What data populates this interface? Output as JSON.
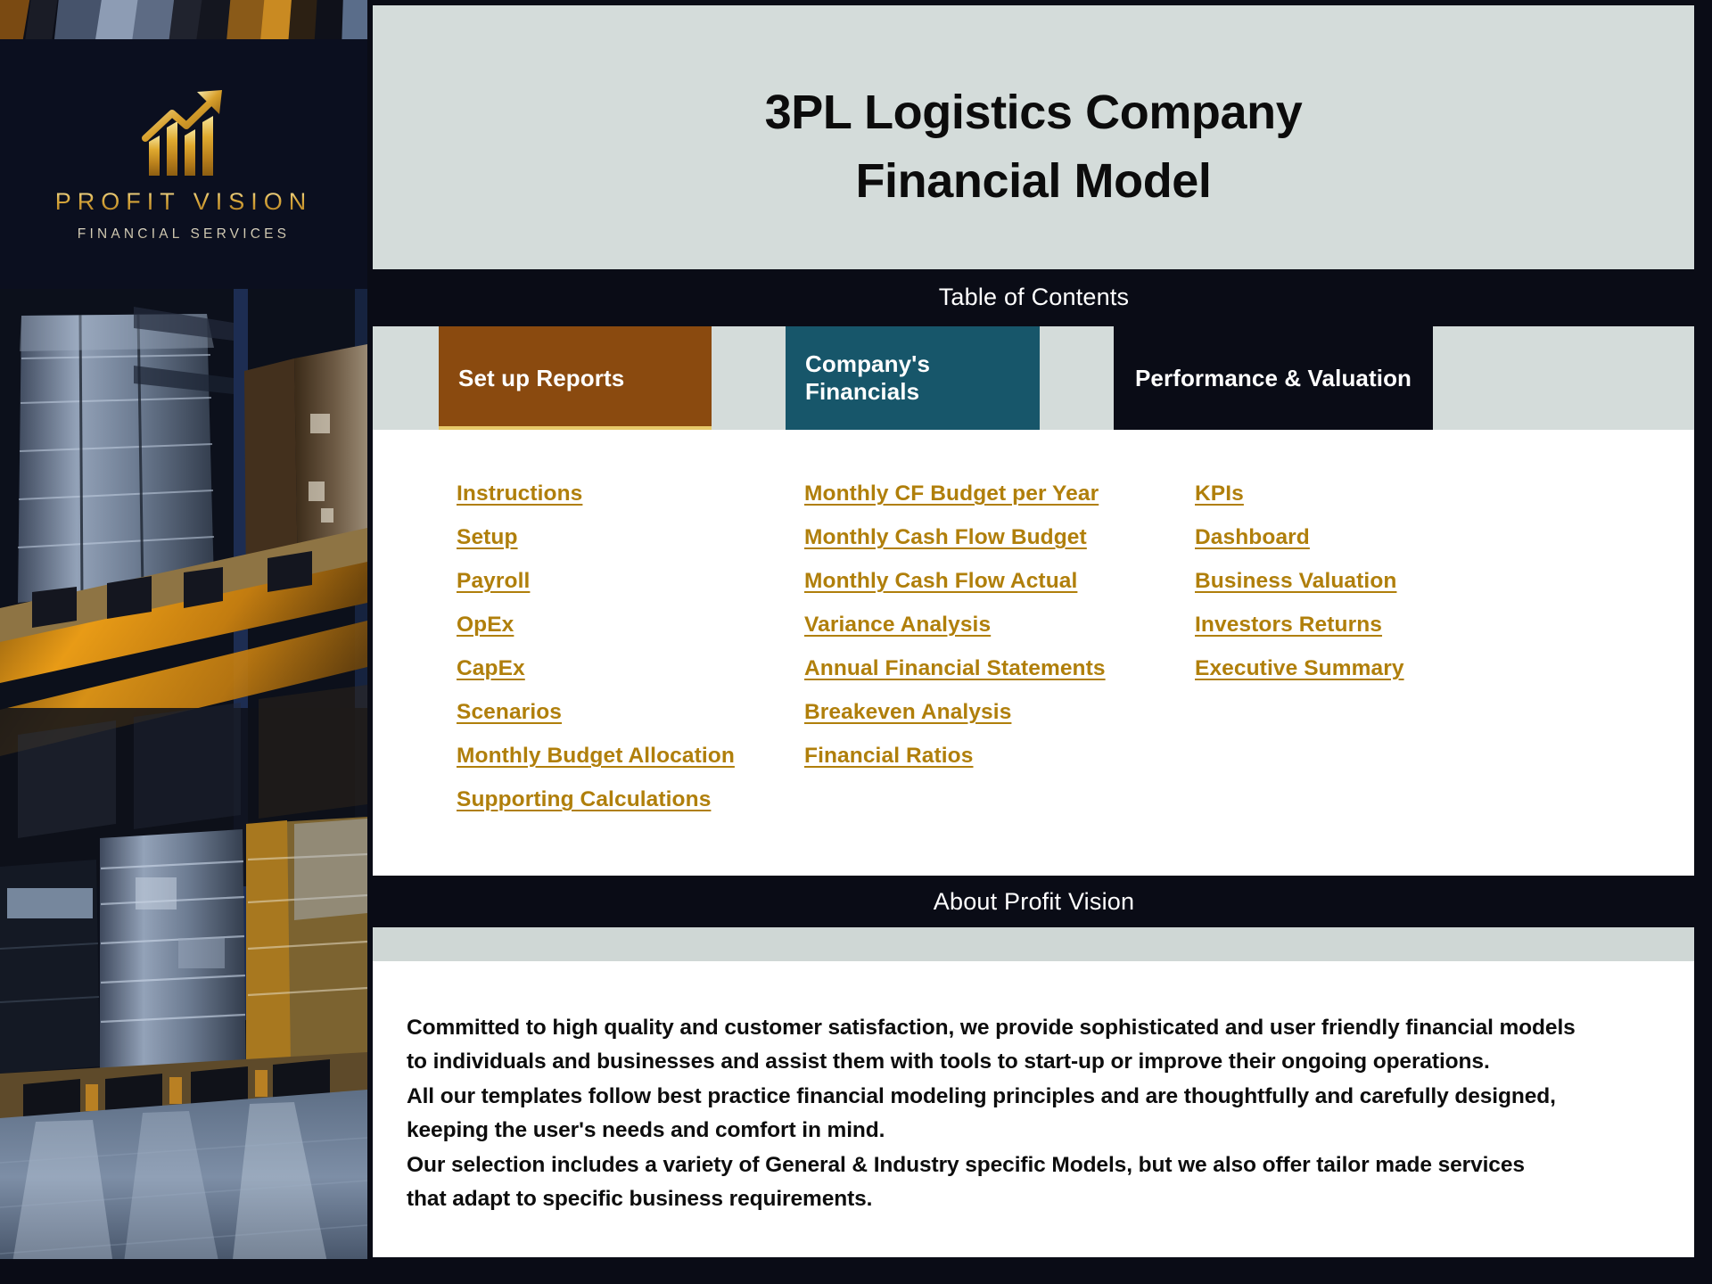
{
  "brand": {
    "name": "PROFIT VISION",
    "tagline": "FINANCIAL SERVICES",
    "logo_icon": "growth-chart-arrow-icon"
  },
  "header": {
    "title_line1": "3PL Logistics Company",
    "title_line2": "Financial Model"
  },
  "toc": {
    "band_label": "Table of Contents",
    "tabs": [
      {
        "label": "Set up Reports",
        "color": "#8a4a0f"
      },
      {
        "label": "Company's Financials",
        "color": "#17566a"
      },
      {
        "label": "Performance & Valuation",
        "color": "#0a0c16"
      }
    ],
    "columns": [
      {
        "heading": "Set up Reports",
        "links": [
          "Instructions",
          "Setup",
          "Payroll",
          "OpEx",
          "CapEx",
          "Scenarios",
          "Monthly Budget Allocation",
          "Supporting Calculations"
        ]
      },
      {
        "heading": "Company's Financials",
        "links": [
          "Monthly CF Budget per Year",
          "Monthly Cash Flow Budget",
          "Monthly Cash Flow Actual",
          "Variance Analysis",
          "Annual Financial Statements",
          "Breakeven Analysis",
          "Financial Ratios"
        ]
      },
      {
        "heading": "Performance & Valuation",
        "links": [
          "KPIs",
          "Dashboard",
          "Business Valuation",
          "Investors Returns",
          "Executive Summary"
        ]
      }
    ]
  },
  "about": {
    "band_label": "About Profit Vision",
    "lines": [
      "Committed to high quality and customer satisfaction, we provide sophisticated and user friendly financial models",
      "to individuals and businesses and assist them  with tools to start-up or improve their ongoing operations.",
      "All our templates follow best practice financial modeling principles and are thoughtfully and carefully designed,",
      "keeping the user's needs and comfort in mind.",
      "Our selection includes a variety of General & Industry specific Models, but we also offer tailor made services",
      "that adapt to specific business requirements."
    ]
  },
  "colors": {
    "accent_gold": "#b07f0b",
    "brand_brown": "#8a4a0f",
    "brand_teal": "#17566a",
    "dark_navy": "#0a0c16",
    "panel_gray": "#d4dcda"
  },
  "left_image": {
    "alt": "warehouse-pallet-racking-photo"
  }
}
